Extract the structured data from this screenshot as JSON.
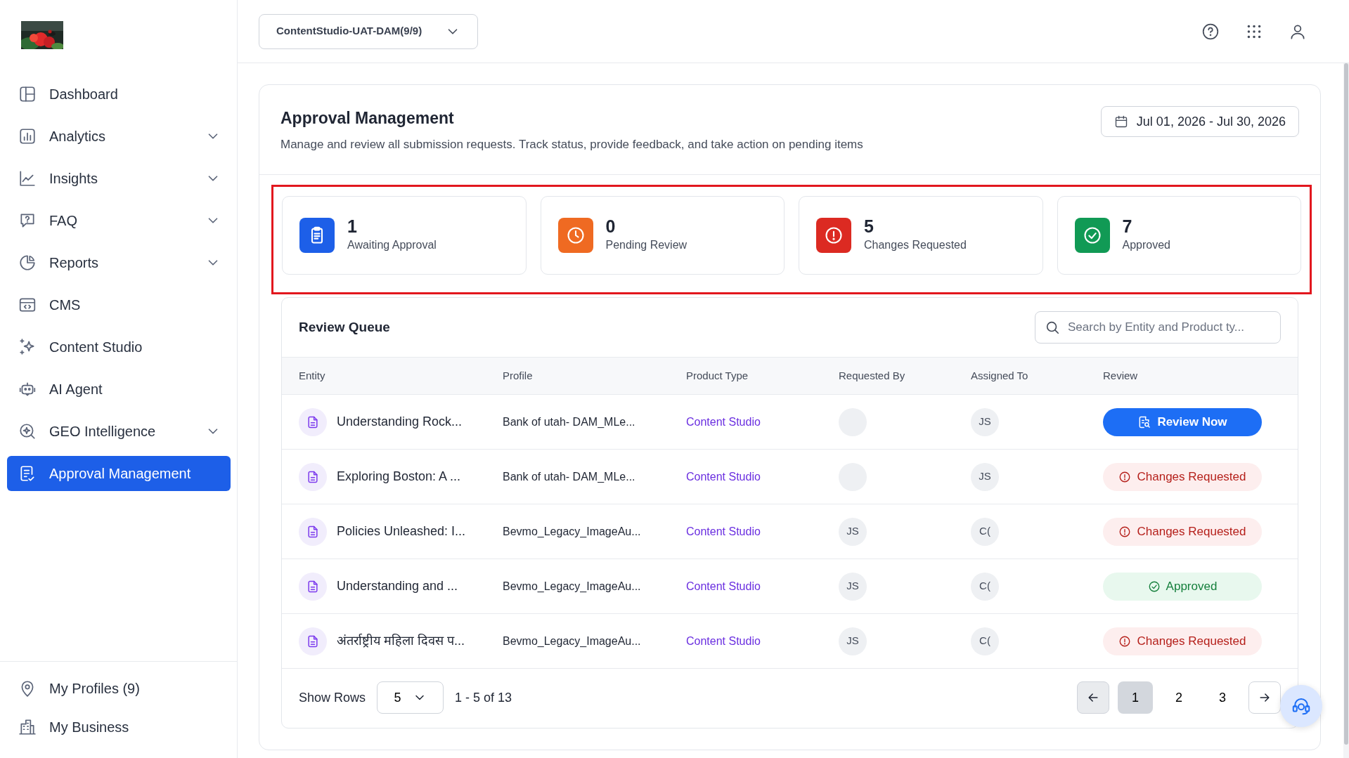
{
  "sidebar": {
    "items": [
      {
        "label": "Dashboard",
        "collapsible": false,
        "selected": false
      },
      {
        "label": "Analytics",
        "collapsible": true,
        "selected": false
      },
      {
        "label": "Insights",
        "collapsible": true,
        "selected": false
      },
      {
        "label": "FAQ",
        "collapsible": true,
        "selected": false
      },
      {
        "label": "Reports",
        "collapsible": true,
        "selected": false
      },
      {
        "label": "CMS",
        "collapsible": false,
        "selected": false
      },
      {
        "label": "Content Studio",
        "collapsible": false,
        "selected": false
      },
      {
        "label": "AI Agent",
        "collapsible": false,
        "selected": false
      },
      {
        "label": "GEO Intelligence",
        "collapsible": true,
        "selected": false
      },
      {
        "label": "Approval Management",
        "collapsible": false,
        "selected": true
      }
    ],
    "bottom_items": [
      {
        "label": "My Profiles (9)"
      },
      {
        "label": "My Business"
      }
    ]
  },
  "topbar": {
    "workspace": "ContentStudio-UAT-DAM(9/9)"
  },
  "page": {
    "title": "Approval Management",
    "subtitle": "Manage and review all submission requests. Track status, provide feedback, and take action on pending items",
    "date_range": "Jul 01, 2026 - Jul 30, 2026"
  },
  "stats": [
    {
      "kind": "awaiting",
      "count": "1",
      "label": "Awaiting Approval",
      "color": "#1d5fe8"
    },
    {
      "kind": "pending",
      "count": "0",
      "label": "Pending Review",
      "color": "#ef6a22"
    },
    {
      "kind": "changes",
      "count": "5",
      "label": "Changes Requested",
      "color": "#dc2a22"
    },
    {
      "kind": "approved",
      "count": "7",
      "label": "Approved",
      "color": "#119a55"
    }
  ],
  "review_queue": {
    "title": "Review Queue",
    "search": {
      "placeholder": "Search by Entity and Product ty..."
    },
    "columns": [
      "Entity",
      "Profile",
      "Product Type",
      "Requested By",
      "Assigned To",
      "Review"
    ],
    "rows": [
      {
        "entity": "Understanding Rock...",
        "profile": "Bank of utah- DAM_MLe...",
        "product_type": "Content Studio",
        "assigned_to": "JS",
        "review": {
          "kind": "button",
          "label": "Review Now"
        }
      },
      {
        "entity": "Exploring Boston: A ...",
        "profile": "Bank of utah- DAM_MLe...",
        "product_type": "Content Studio",
        "assigned_to": "JS",
        "review": {
          "kind": "changes",
          "label": "Changes Requested"
        }
      },
      {
        "entity": "Policies Unleashed: I...",
        "profile": "Bevmo_Legacy_ImageAu...",
        "product_type": "Content Studio",
        "requested_by": "JS",
        "assigned_to": "C(",
        "review": {
          "kind": "changes",
          "label": "Changes Requested"
        }
      },
      {
        "entity": "Understanding and ...",
        "profile": "Bevmo_Legacy_ImageAu...",
        "product_type": "Content Studio",
        "requested_by": "JS",
        "assigned_to": "C(",
        "review": {
          "kind": "approved",
          "label": "Approved"
        }
      },
      {
        "entity": "अंतर्राष्ट्रीय महिला दिवस प...",
        "profile": "Bevmo_Legacy_ImageAu...",
        "product_type": "Content Studio",
        "requested_by": "JS",
        "assigned_to": "C(",
        "review": {
          "kind": "changes",
          "label": "Changes Requested"
        }
      }
    ],
    "footer": {
      "show_rows_label": "Show Rows",
      "rows_per_page": "5",
      "range": "1 - 5 of 13",
      "pages": [
        {
          "label": "1",
          "selected": true
        },
        {
          "label": "2",
          "selected": false
        },
        {
          "label": "3",
          "selected": false
        }
      ]
    }
  }
}
